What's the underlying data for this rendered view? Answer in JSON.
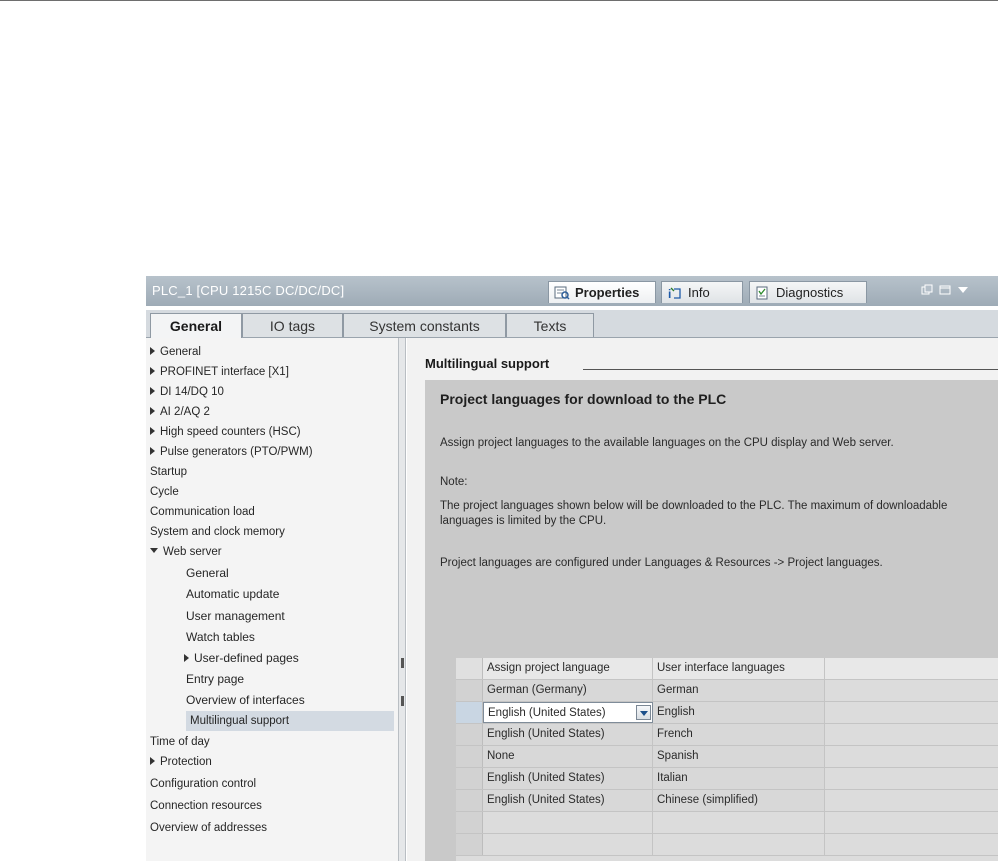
{
  "window": {
    "title": "PLC_1 [CPU 1215C DC/DC/DC]",
    "properties_label": "Properties",
    "info_label": "Info",
    "diagnostics_label": "Diagnostics"
  },
  "tabs": [
    "General",
    "IO tags",
    "System constants",
    "Texts"
  ],
  "nav": [
    {
      "label": "General",
      "arrow": "right"
    },
    {
      "label": "PROFINET interface [X1]",
      "arrow": "right"
    },
    {
      "label": "DI 14/DQ 10",
      "arrow": "right"
    },
    {
      "label": "AI 2/AQ 2",
      "arrow": "right"
    },
    {
      "label": "High speed counters (HSC)",
      "arrow": "right"
    },
    {
      "label": "Pulse generators (PTO/PWM)",
      "arrow": "right"
    },
    {
      "label": "Startup"
    },
    {
      "label": "Cycle"
    },
    {
      "label": "Communication load"
    },
    {
      "label": "System and clock memory"
    },
    {
      "label": "Web server",
      "arrow": "down"
    },
    {
      "label": "General"
    },
    {
      "label": "Automatic update"
    },
    {
      "label": "User management"
    },
    {
      "label": "Watch tables"
    },
    {
      "label": "User-defined pages",
      "arrow": "right"
    },
    {
      "label": "Entry page"
    },
    {
      "label": "Overview of interfaces"
    },
    {
      "label": "Multilingual support",
      "selected": true
    },
    {
      "label": "Time of day"
    },
    {
      "label": "Protection",
      "arrow": "right"
    },
    {
      "label": "Configuration control"
    },
    {
      "label": "Connection resources"
    },
    {
      "label": "Overview of addresses"
    }
  ],
  "content": {
    "section_title": "Multilingual support",
    "subsection_title": "Project languages for download to the PLC",
    "para1": "Assign project languages to the available languages on the CPU display and Web server.",
    "note_label": "Note:",
    "para2": "The project languages shown below will be downloaded to the PLC. The maximum of downloadable languages is limited by the CPU.",
    "para3": "Project languages are configured under Languages & Resources -> Project languages."
  },
  "table": {
    "headers": [
      "Assign project language",
      "User interface languages"
    ],
    "rows": [
      [
        "German (Germany)",
        "German"
      ],
      [
        "English (United States)",
        "English"
      ],
      [
        "English (United States)",
        "French"
      ],
      [
        "None",
        "Spanish"
      ],
      [
        "English (United States)",
        "Italian"
      ],
      [
        "English (United States)",
        "Chinese (simplified)"
      ]
    ],
    "editing_row": 1
  }
}
